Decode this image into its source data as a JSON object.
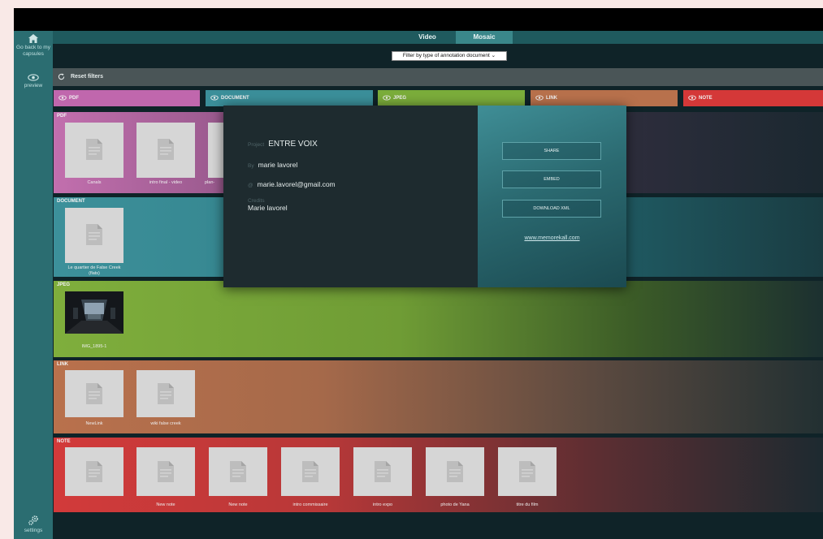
{
  "app": {
    "sidebar": {
      "home_label": "Go back to my capsules",
      "preview_label": "preview",
      "settings_label": "settings"
    },
    "view_tabs": [
      {
        "label": "Video",
        "active": false
      },
      {
        "label": "Mosaic",
        "active": true
      }
    ],
    "filter": {
      "selected": "Filter by type of annotation document ⌄"
    },
    "reset_label": "Reset filters",
    "filter_tabs": [
      {
        "label": "PDF",
        "color": "#c067ad"
      },
      {
        "label": "DOCUMENT",
        "color": "#3b8f9a"
      },
      {
        "label": "JPEG",
        "color": "#7bad3b"
      },
      {
        "label": "LINK",
        "color": "#b8714c"
      },
      {
        "label": "NOTE",
        "color": "#d43838"
      }
    ],
    "sections": {
      "pdf": {
        "title": "PDF",
        "items": [
          "Canals",
          "intro final - video",
          "plan-"
        ]
      },
      "document": {
        "title": "DOCUMENT",
        "items": [
          "Le quartier de False Creek (flats)"
        ]
      },
      "jpeg": {
        "title": "JPEG",
        "items": [
          "IMG_1895-1"
        ]
      },
      "link": {
        "title": "LINK",
        "items": [
          "NewLink",
          "wiki false creek"
        ]
      },
      "note": {
        "title": "NOTE",
        "items": [
          "New note",
          "New note",
          "intro commissaire",
          "intro expo",
          "photo de Yana",
          "titre du film"
        ]
      }
    },
    "modal": {
      "project_label": "Project",
      "project_value": "ENTRE VOIX",
      "by_label": "By",
      "by_value": "marie lavorel",
      "at_label": "@",
      "email": "marie.lavorel@gmail.com",
      "credits_label": "Credits",
      "credits_value": "Marie lavorel",
      "buttons": {
        "share": "SHARE",
        "embed": "EMBED",
        "download": "DOWNLOAD XML"
      },
      "link": "www.memorekall.com"
    }
  }
}
